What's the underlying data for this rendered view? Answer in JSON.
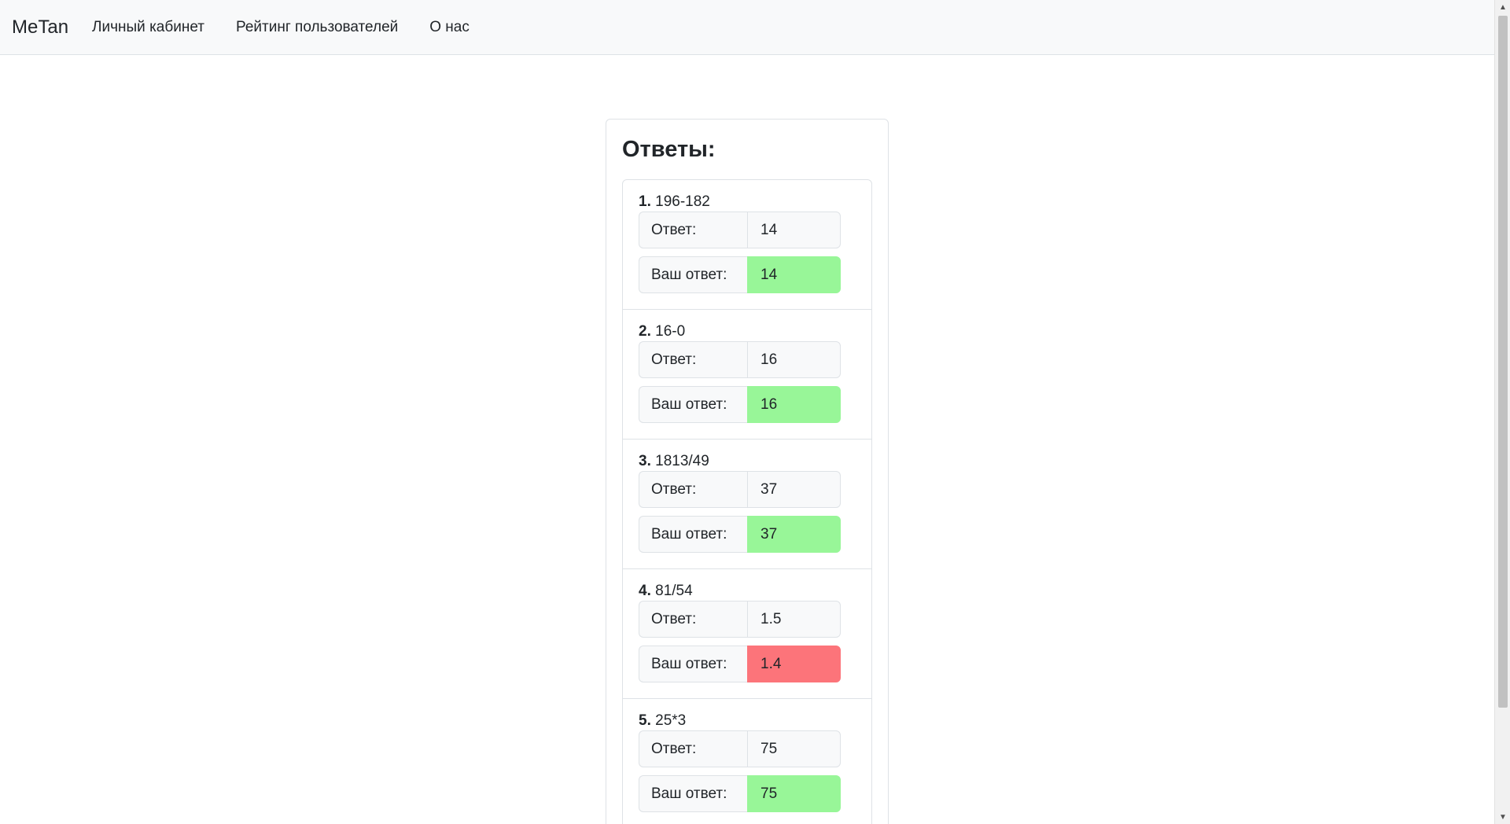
{
  "navbar": {
    "brand": "MeTan",
    "links": [
      "Личный кабинет",
      "Рейтинг пользователей",
      "О нас"
    ]
  },
  "card": {
    "title": "Ответы:",
    "answer_label": "Ответ:",
    "your_answer_label": "Ваш ответ:",
    "items": [
      {
        "num": "1.",
        "question": "196-182",
        "answer": "14",
        "your_answer": "14",
        "status": "correct"
      },
      {
        "num": "2.",
        "question": "16-0",
        "answer": "16",
        "your_answer": "16",
        "status": "correct"
      },
      {
        "num": "3.",
        "question": "1813/49",
        "answer": "37",
        "your_answer": "37",
        "status": "correct"
      },
      {
        "num": "4.",
        "question": "81/54",
        "answer": "1.5",
        "your_answer": "1.4",
        "status": "wrong"
      },
      {
        "num": "5.",
        "question": "25*3",
        "answer": "75",
        "your_answer": "75",
        "status": "correct"
      }
    ]
  },
  "colors": {
    "correct": "#98f698",
    "wrong": "#fc747a",
    "navbar_bg": "#f8f9fa"
  }
}
